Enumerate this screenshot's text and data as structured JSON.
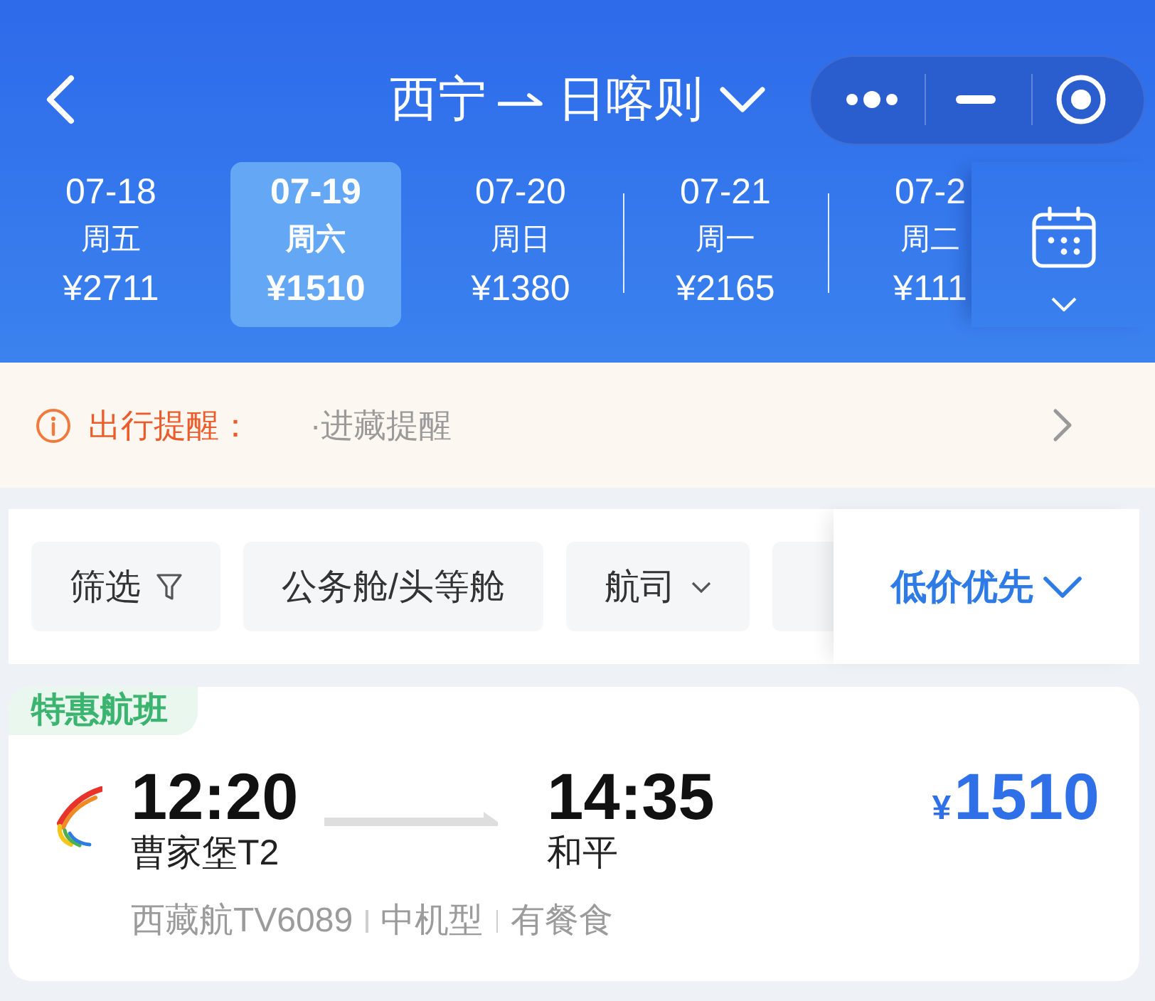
{
  "nav": {
    "origin": "西宁",
    "destination": "日喀则"
  },
  "dates": [
    {
      "date": "07-18",
      "weekday": "周五",
      "price": "¥2711",
      "selected": false
    },
    {
      "date": "07-19",
      "weekday": "周六",
      "price": "¥1510",
      "selected": true
    },
    {
      "date": "07-20",
      "weekday": "周日",
      "price": "¥1380",
      "selected": false
    },
    {
      "date": "07-21",
      "weekday": "周一",
      "price": "¥2165",
      "selected": false
    },
    {
      "date": "07-2",
      "weekday": "周二",
      "price": "¥111",
      "selected": false
    }
  ],
  "notice": {
    "label": "出行提醒：",
    "text": "·进藏提醒"
  },
  "filters": [
    {
      "label": "筛选",
      "kind": "funnel"
    },
    {
      "label": "公务舱/头等舱",
      "kind": "plain"
    },
    {
      "label": "航司",
      "kind": "dropdown"
    },
    {
      "kind": "plain"
    }
  ],
  "sort": {
    "label": "低价优先"
  },
  "flights": [
    {
      "tag": "特惠航班",
      "depart_time": "12:20",
      "depart_airport": "曹家堡T2",
      "arrive_time": "14:35",
      "arrive_airport": "和平",
      "currency": "¥",
      "price": "1510",
      "details": [
        "西藏航TV6089",
        "中机型",
        "有餐食"
      ]
    }
  ]
}
